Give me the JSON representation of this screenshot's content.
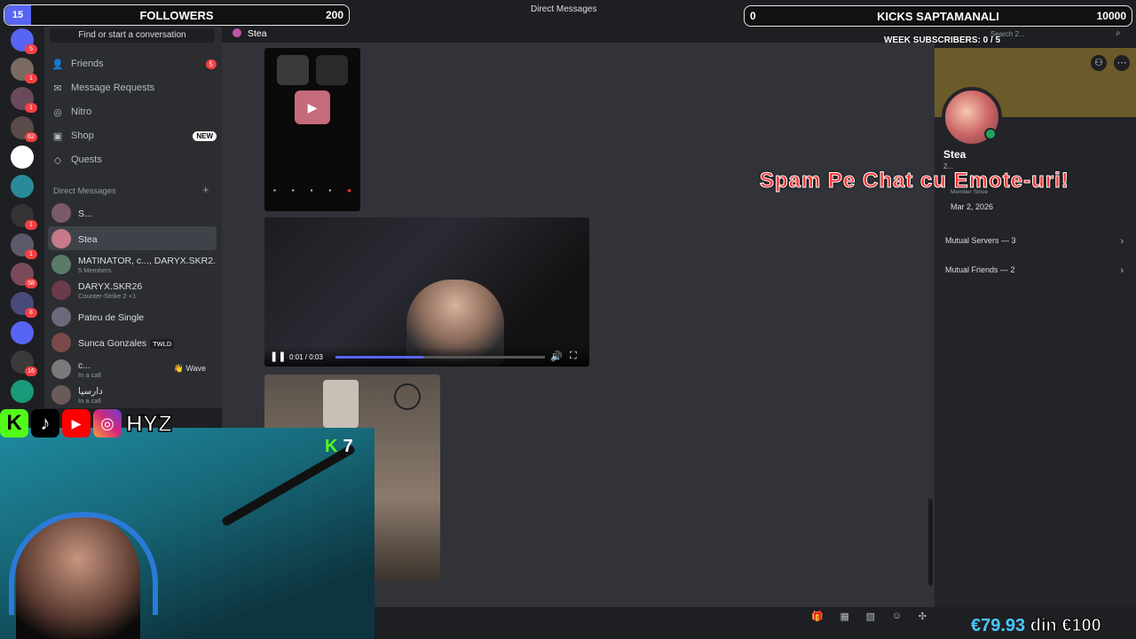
{
  "topbar": {
    "title": "Direct Messages"
  },
  "overlay": {
    "followers": {
      "current": "15",
      "label": "FOLLOWERS",
      "goal": "200"
    },
    "kicks": {
      "current": "0",
      "label": "KICKS SAPTAMANALI",
      "goal": "10000"
    },
    "week_subscribers": "WEEK SUBSCRIBERS: 0 / 5",
    "spam_text": "Spam Pe Chat cu Emote-uri!",
    "kick_counter": "7",
    "social_handle": "HYZ",
    "donation": {
      "current": "€79.93",
      "goal_text": "din €100"
    }
  },
  "rail": {
    "servers": [
      {
        "name": "discord-home",
        "badge": "5",
        "color": "#5865f2"
      },
      {
        "name": "server-1",
        "badge": "1",
        "color": "#7a6a60"
      },
      {
        "name": "server-2",
        "badge": "1",
        "color": "#6a4a5a"
      },
      {
        "name": "server-3",
        "badge": "62",
        "color": "#5a4a4a"
      },
      {
        "name": "server-4",
        "badge": "",
        "color": "#ffffff"
      },
      {
        "name": "server-5",
        "badge": "",
        "color": "#2a8a9a"
      },
      {
        "name": "server-6",
        "badge": "1",
        "color": "#333333"
      },
      {
        "name": "server-7",
        "badge": "1",
        "color": "#5a5a6a"
      },
      {
        "name": "server-8",
        "badge": "58",
        "color": "#7a4a5a"
      },
      {
        "name": "server-9",
        "badge": "8",
        "color": "#4a4a7a"
      },
      {
        "name": "server-10",
        "badge": "",
        "color": "#5865f2"
      },
      {
        "name": "server-11",
        "badge": "16",
        "color": "#3a3a3a"
      },
      {
        "name": "server-12",
        "badge": "",
        "color": "#1a9a7a"
      }
    ]
  },
  "sidebar": {
    "search_placeholder": "Find or start a conversation",
    "nav": [
      {
        "label": "Friends",
        "icon": "👤",
        "pill": "5"
      },
      {
        "label": "Message Requests",
        "icon": "✉",
        "pill": ""
      },
      {
        "label": "Nitro",
        "icon": "◎",
        "pill": ""
      },
      {
        "label": "Shop",
        "icon": "▣",
        "pill": "NEW"
      },
      {
        "label": "Quests",
        "icon": "◇",
        "pill": ""
      }
    ],
    "dm_header": "Direct Messages",
    "dms": [
      {
        "name": "S...",
        "sub": "",
        "tag": "",
        "extra": "",
        "color": "#7a5a6a"
      },
      {
        "name": "Stea",
        "sub": "",
        "tag": "",
        "extra": "",
        "color": "#c67a8a"
      },
      {
        "name": "MATINATOR, c..., DARYX.SKR2...",
        "sub": "5 Members",
        "tag": "",
        "extra": "",
        "color": "#5a7a6a"
      },
      {
        "name": "DARYX.SKR26",
        "sub": "Counter-Strike 2 +1",
        "tag": "",
        "extra": "",
        "color": "#6a3a4a"
      },
      {
        "name": "Pateu de Single",
        "sub": "",
        "tag": "",
        "extra": "",
        "color": "#6a6a7a"
      },
      {
        "name": "Sunca Gonzales",
        "sub": "",
        "tag": "TWLD",
        "extra": "",
        "color": "#7a4a4a"
      },
      {
        "name": "c...",
        "sub": "In a call",
        "tag": "",
        "extra": "👋 Wave",
        "color": "#7a7a7a"
      },
      {
        "name": "دارسيا",
        "sub": "In a call",
        "tag": "",
        "extra": "",
        "color": "#6a5a5a"
      }
    ]
  },
  "channel": {
    "name": "Stea"
  },
  "video": {
    "time": "0:01 / 0:03",
    "progress": 0.42
  },
  "profile": {
    "name": "Stea",
    "tag": "2...",
    "member_since_label": "Member Since",
    "date": "Mar 2, 2026",
    "mutual_servers": "Mutual Servers — 3",
    "mutual_friends": "Mutual Friends — 2"
  },
  "search": {
    "placeholder": "Search 2..."
  }
}
